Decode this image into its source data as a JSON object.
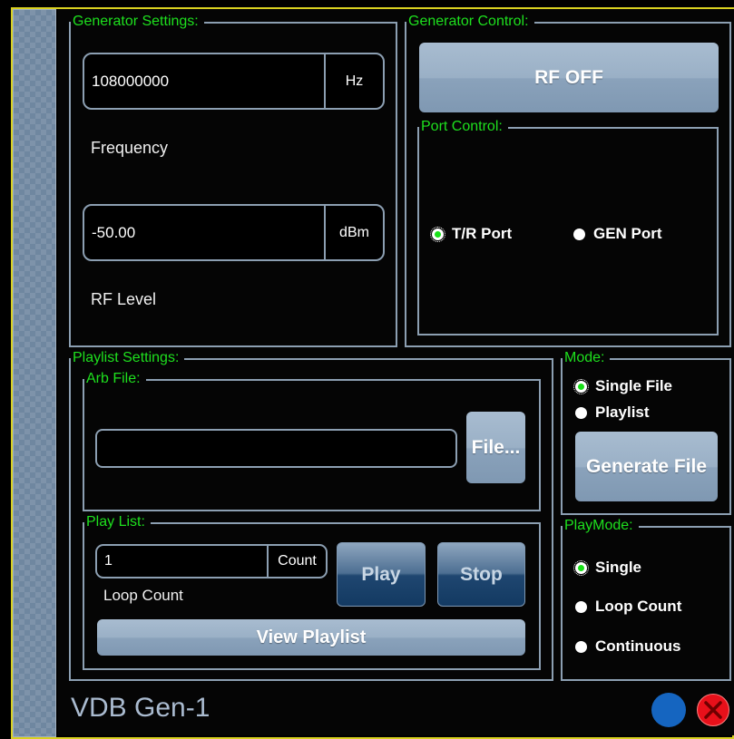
{
  "generator_settings": {
    "title": "Generator Settings:",
    "frequency": {
      "value": "108000000",
      "unit": "Hz",
      "label": "Frequency"
    },
    "rf_level": {
      "value": "-50.00",
      "unit": "dBm",
      "label": "RF Level"
    }
  },
  "generator_control": {
    "title": "Generator Control:",
    "rf_button": "RF OFF",
    "port_control": {
      "title": "Port Control:",
      "options": [
        {
          "label": "T/R Port",
          "selected": true
        },
        {
          "label": "GEN Port",
          "selected": false
        }
      ]
    }
  },
  "playlist_settings": {
    "title": "Playlist Settings:",
    "arb_file": {
      "title": "Arb File:",
      "path_value": "",
      "file_button": "File..."
    },
    "play_list": {
      "title": "Play List:",
      "count_value": "1",
      "count_unit": "Count",
      "loop_count_label": "Loop Count",
      "play_button": "Play",
      "stop_button": "Stop",
      "view_playlist_button": "View Playlist"
    }
  },
  "mode": {
    "title": "Mode:",
    "options": [
      {
        "label": "Single File",
        "selected": true
      },
      {
        "label": "Playlist",
        "selected": false
      }
    ],
    "generate_button": "Generate File"
  },
  "play_mode": {
    "title": "PlayMode:",
    "options": [
      {
        "label": "Single",
        "selected": true
      },
      {
        "label": "Loop Count",
        "selected": false
      },
      {
        "label": "Continuous",
        "selected": false
      }
    ]
  },
  "footer": {
    "window_title": "VDB Gen-1",
    "status_color": "#1565c0",
    "close_color": "#e8101a"
  },
  "colors": {
    "group_label": "#1ee01e",
    "accent_border": "#d8d020"
  }
}
